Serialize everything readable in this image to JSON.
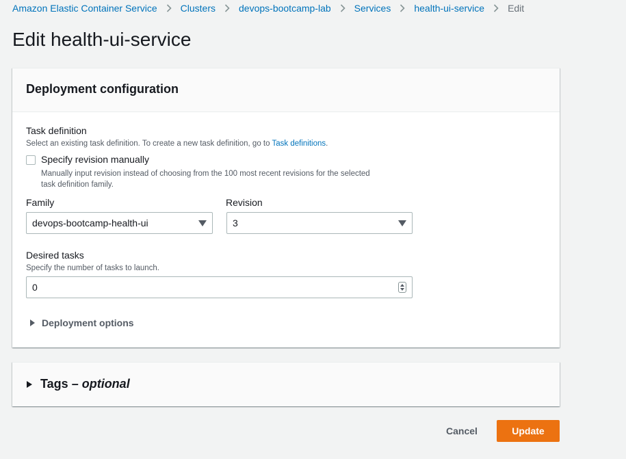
{
  "breadcrumb": {
    "items": [
      {
        "label": "Amazon Elastic Container Service"
      },
      {
        "label": "Clusters"
      },
      {
        "label": "devops-bootcamp-lab"
      },
      {
        "label": "Services"
      },
      {
        "label": "health-ui-service"
      }
    ],
    "current": "Edit"
  },
  "page_title": "Edit health-ui-service",
  "deployment": {
    "title": "Deployment configuration",
    "task_definition": {
      "label": "Task definition",
      "desc_prefix": "Select an existing task definition. To create a new task definition, go to ",
      "desc_link": "Task definitions",
      "desc_suffix": ".",
      "specify_revision_label": "Specify revision manually",
      "specify_revision_desc_line1": "Manually input revision instead of choosing from the 100 most recent revisions for the selected",
      "specify_revision_desc_line2": "task definition family.",
      "specify_revision_checked": false
    },
    "family": {
      "label": "Family",
      "value": "devops-bootcamp-health-ui"
    },
    "revision": {
      "label": "Revision",
      "value": "3"
    },
    "desired_tasks": {
      "label": "Desired tasks",
      "desc": "Specify the number of tasks to launch.",
      "value": "0"
    },
    "deployment_options_label": "Deployment options"
  },
  "tags": {
    "label": "Tags",
    "dash": " – ",
    "optional": "optional"
  },
  "actions": {
    "cancel": "Cancel",
    "update": "Update"
  },
  "colors": {
    "primary_button": "#ec7211",
    "link": "#0073bb",
    "background": "#f2f3f3"
  }
}
